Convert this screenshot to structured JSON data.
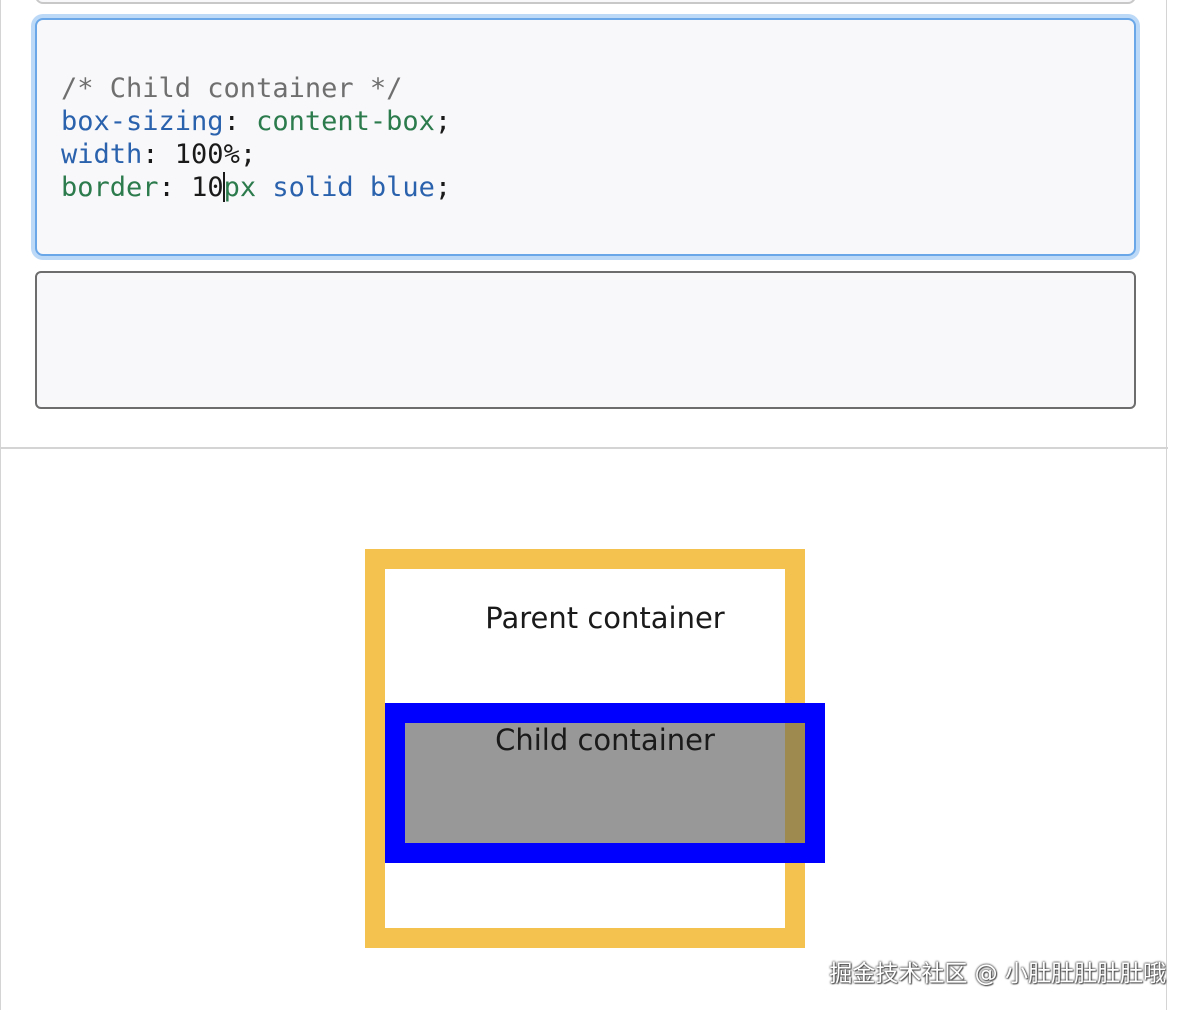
{
  "editor": {
    "line1": {
      "comment": "/* Child container */"
    },
    "line2": {
      "prop": "box-sizing",
      "colon": ": ",
      "value": "content-box",
      "end": ";"
    },
    "line3": {
      "prop": "width",
      "colon": ": ",
      "value": "100%",
      "end": ";"
    },
    "line4": {
      "prop": "border",
      "colon": ": ",
      "value_a": "10",
      "value_b": "px",
      "value_c": " solid blue",
      "end": ";"
    }
  },
  "preview": {
    "parent_label": "Parent container",
    "child_label": "Child container",
    "parent_border_color": "#f4c24e",
    "child_border_color": "#0000ff",
    "child_background_color": "#989898"
  },
  "watermark": "掘金技术社区 @ 小肚肚肚肚肚哦"
}
